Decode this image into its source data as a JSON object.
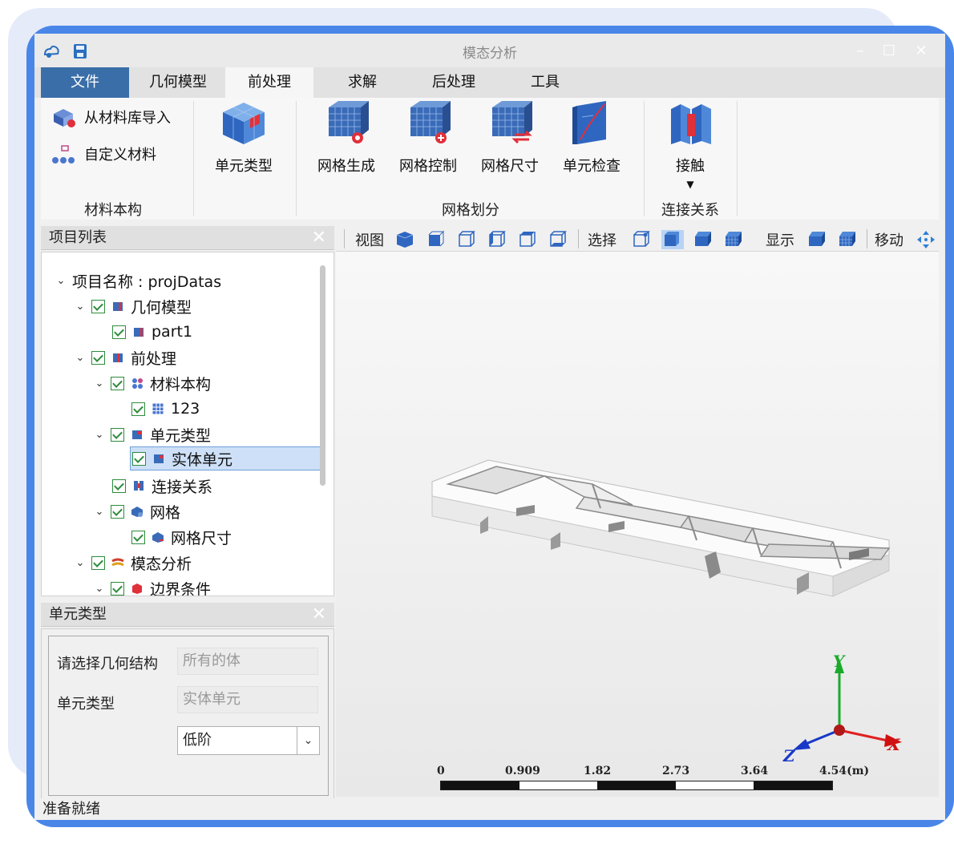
{
  "window": {
    "title": "模态分析"
  },
  "menu": {
    "file": "文件",
    "tabs": [
      "几何模型",
      "前处理",
      "求解",
      "后处理",
      "工具"
    ]
  },
  "ribbon": {
    "material": {
      "import": "从材料库导入",
      "custom": "自定义材料",
      "group": "材料本构"
    },
    "element": {
      "type": "单元类型"
    },
    "mesh": {
      "generate": "网格生成",
      "control": "网格控制",
      "size": "网格尺寸",
      "check": "单元检查",
      "group": "网格划分"
    },
    "contact": {
      "label": "接触",
      "group": "连接关系"
    }
  },
  "project_panel": {
    "title": "项目列表",
    "tree": [
      "项目名称 : projDatas",
      "几何模型",
      "part1",
      "前处理",
      "材料本构",
      "123",
      "单元类型",
      "实体单元",
      "连接关系",
      "网格",
      "网格尺寸",
      "模态分析",
      "边界条件"
    ]
  },
  "element_panel": {
    "title": "单元类型",
    "geometry_label": "请选择几何结构",
    "geometry_value": "所有的体",
    "type_label": "单元类型",
    "type_value": "实体单元",
    "order_value": "低阶"
  },
  "view_toolbar": {
    "view": "视图",
    "select": "选择",
    "display": "显示",
    "move": "移动"
  },
  "axes": {
    "x": "X",
    "y": "Y",
    "z": "Z"
  },
  "scale": {
    "ticks": [
      "0",
      "0.909",
      "1.82",
      "2.73",
      "3.64",
      "4.54(m)"
    ]
  },
  "status": "准备就绪",
  "colors": {
    "accent": "#3a6ea8",
    "frame": "#4a86e8",
    "selected": "#cde0f7",
    "check": "#2e8b3c"
  }
}
